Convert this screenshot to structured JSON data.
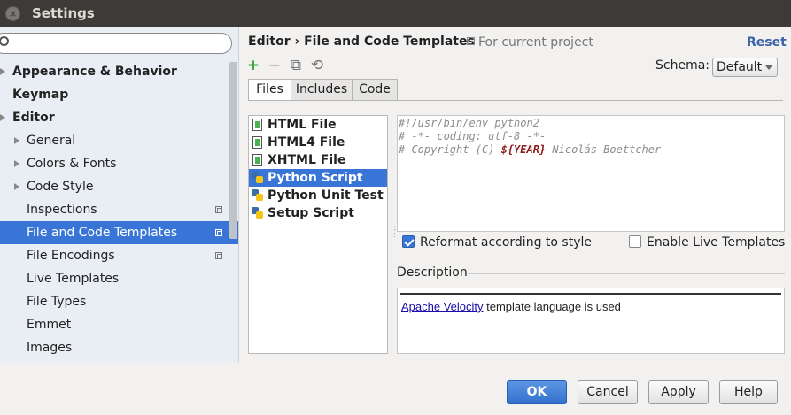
{
  "window": {
    "title": "Settings",
    "close_glyph": "×"
  },
  "sidebar": {
    "search": {
      "value": "",
      "placeholder": ""
    },
    "items": [
      {
        "label": "Appearance & Behavior",
        "level": 0,
        "bold": true,
        "arrow": true,
        "selected": false,
        "project": false
      },
      {
        "label": "Keymap",
        "level": 0,
        "bold": true,
        "arrow": false,
        "selected": false,
        "project": false
      },
      {
        "label": "Editor",
        "level": 0,
        "bold": true,
        "arrow": true,
        "selected": false,
        "project": false
      },
      {
        "label": "General",
        "level": 1,
        "bold": false,
        "arrow": true,
        "selected": false,
        "project": false
      },
      {
        "label": "Colors & Fonts",
        "level": 1,
        "bold": false,
        "arrow": true,
        "selected": false,
        "project": false
      },
      {
        "label": "Code Style",
        "level": 1,
        "bold": false,
        "arrow": true,
        "selected": false,
        "project": false
      },
      {
        "label": "Inspections",
        "level": 1,
        "bold": false,
        "arrow": false,
        "selected": false,
        "project": true
      },
      {
        "label": "File and Code Templates",
        "level": 1,
        "bold": false,
        "arrow": false,
        "selected": true,
        "project": true
      },
      {
        "label": "File Encodings",
        "level": 1,
        "bold": false,
        "arrow": false,
        "selected": false,
        "project": true
      },
      {
        "label": "Live Templates",
        "level": 1,
        "bold": false,
        "arrow": false,
        "selected": false,
        "project": false
      },
      {
        "label": "File Types",
        "level": 1,
        "bold": false,
        "arrow": false,
        "selected": false,
        "project": false
      },
      {
        "label": "Emmet",
        "level": 1,
        "bold": false,
        "arrow": false,
        "selected": false,
        "project": false
      },
      {
        "label": "Images",
        "level": 1,
        "bold": false,
        "arrow": false,
        "selected": false,
        "project": false
      }
    ]
  },
  "header": {
    "breadcrumb": "Editor › File and Code Templates",
    "scope": "For current project",
    "reset": "Reset"
  },
  "toolbar": {
    "add": "+",
    "remove": "−",
    "copy": "⧉",
    "reset_template": "⟲"
  },
  "schema": {
    "label": "Schema:",
    "value": "Default"
  },
  "tabs": [
    {
      "label": "Files",
      "active": true
    },
    {
      "label": "Includes",
      "active": false
    },
    {
      "label": "Code",
      "active": false
    }
  ],
  "templates": [
    {
      "label": "HTML File",
      "icon": "html-file-icon",
      "selected": false
    },
    {
      "label": "HTML4 File",
      "icon": "html-file-icon",
      "selected": false
    },
    {
      "label": "XHTML File",
      "icon": "html-file-icon",
      "selected": false
    },
    {
      "label": "Python Script",
      "icon": "python-icon",
      "selected": true
    },
    {
      "label": "Python Unit Test",
      "icon": "python-icon",
      "selected": false
    },
    {
      "label": "Setup Script",
      "icon": "python-icon",
      "selected": false
    }
  ],
  "editor": {
    "line1": "#!/usr/bin/env python2",
    "line2": "# -*- coding: utf-8 -*-",
    "line3_prefix": "# Copyright (C) ",
    "line3_var": "${YEAR}",
    "line3_suffix": " Nicolás Boettcher"
  },
  "options": {
    "reformat": {
      "label": "Reformat according to style",
      "checked": true
    },
    "live_templates": {
      "label": "Enable Live Templates",
      "checked": false
    }
  },
  "description": {
    "label": "Description",
    "link": "Apache Velocity",
    "text": " template language is used"
  },
  "buttons": {
    "ok": "OK",
    "cancel": "Cancel",
    "apply": "Apply",
    "help": "Help"
  },
  "colors": {
    "selection": "#3875d7",
    "titlebar": "#3c3b37",
    "reset": "#3a64a8",
    "var": "#8b1a1a"
  }
}
